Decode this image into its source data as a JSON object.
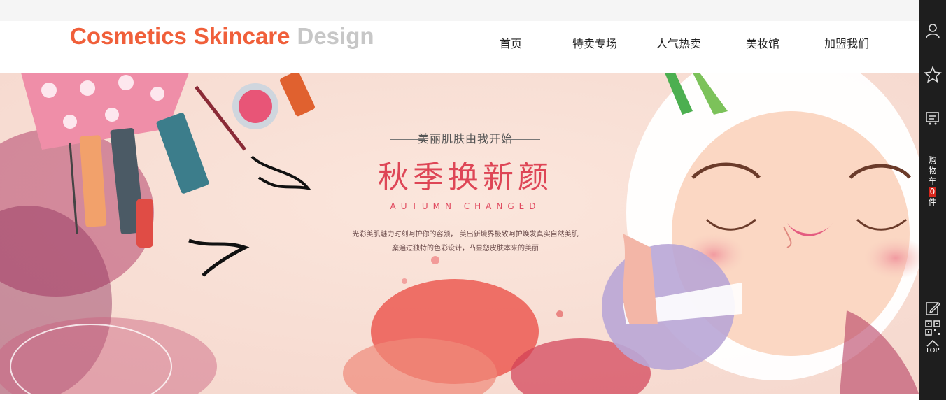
{
  "logo": {
    "part1": "Cosmetics",
    "part2": "Skincare",
    "part3": "Design"
  },
  "nav": [
    "首页",
    "特卖专场",
    "人气热卖",
    "美妆馆",
    "加盟我们"
  ],
  "banner": {
    "tagline": "美丽肌肤由我开始",
    "headline": "秋季换新颜",
    "subline": "AUTUMN CHANGED",
    "desc_line1": "光彩美肌魅力时刻呵护你的容颜， 美出新境界极致呵护焕发真实自然美肌",
    "desc_line2": "糜遍过独特的色彩设计，凸显您皮肤本来的美丽"
  },
  "sidebar": {
    "icons": [
      "user-icon",
      "star-icon",
      "message-icon",
      "edit-icon",
      "qr-code-icon",
      "chevron-up-icon"
    ],
    "cart_chars": [
      "购",
      "物",
      "车"
    ],
    "cart_count": "0",
    "cart_unit": "件",
    "top_label": "TOP"
  },
  "colors": {
    "logo_orange": "#f05f3a",
    "logo_gray": "#c7c7c7",
    "headline_red": "#de4656",
    "sidebar_bg": "#1e1e1e",
    "badge_red": "#d6261c"
  }
}
